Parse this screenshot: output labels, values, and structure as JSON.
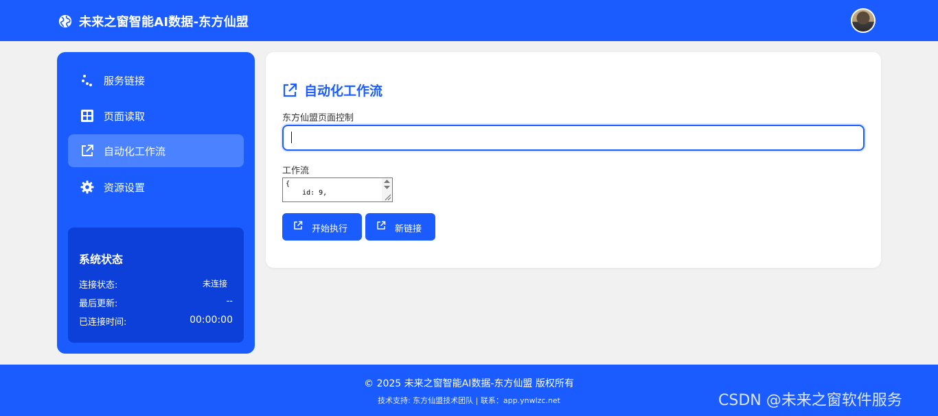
{
  "app": {
    "title": "未来之窗智能AI数据-东方仙盟",
    "globe_icon": "globe-icon",
    "avatar_icon": "user-avatar"
  },
  "sidebar": {
    "items": [
      {
        "label": "服务链接",
        "icon": "dots-icon",
        "active": false
      },
      {
        "label": "页面读取",
        "icon": "grid-icon",
        "active": false
      },
      {
        "label": "自动化工作流",
        "icon": "external-link-icon",
        "active": true
      },
      {
        "label": "资源设置",
        "icon": "gear-icon",
        "active": false
      }
    ],
    "status": {
      "title": "系统状态",
      "rows": [
        {
          "key": "连接状态:",
          "value": "未连接"
        },
        {
          "key": "最后更新:",
          "value": "--"
        },
        {
          "key": "已连接时间:",
          "value": "00:00:00"
        }
      ]
    }
  },
  "main": {
    "title": "自动化工作流",
    "page_control_label": "东方仙盟页面控制",
    "page_control_value": "",
    "workflow_label": "工作流",
    "workflow_value": "{\n    id: 9,",
    "buttons": {
      "start": "开始执行",
      "new_link": "新链接"
    }
  },
  "footer": {
    "copyright": "© 2025 未来之窗智能AI数据-东方仙盟 版权所有",
    "support": "技术支持: 东方仙盟技术团队 | 联系：app.ynwlzc.net"
  },
  "watermark": "CSDN @未来之窗软件服务",
  "colors": {
    "primary": "#1a5cff",
    "active_nav": "#4a82ff",
    "status_bg": "#0d40d8",
    "page_bg": "#f1f1f1"
  }
}
